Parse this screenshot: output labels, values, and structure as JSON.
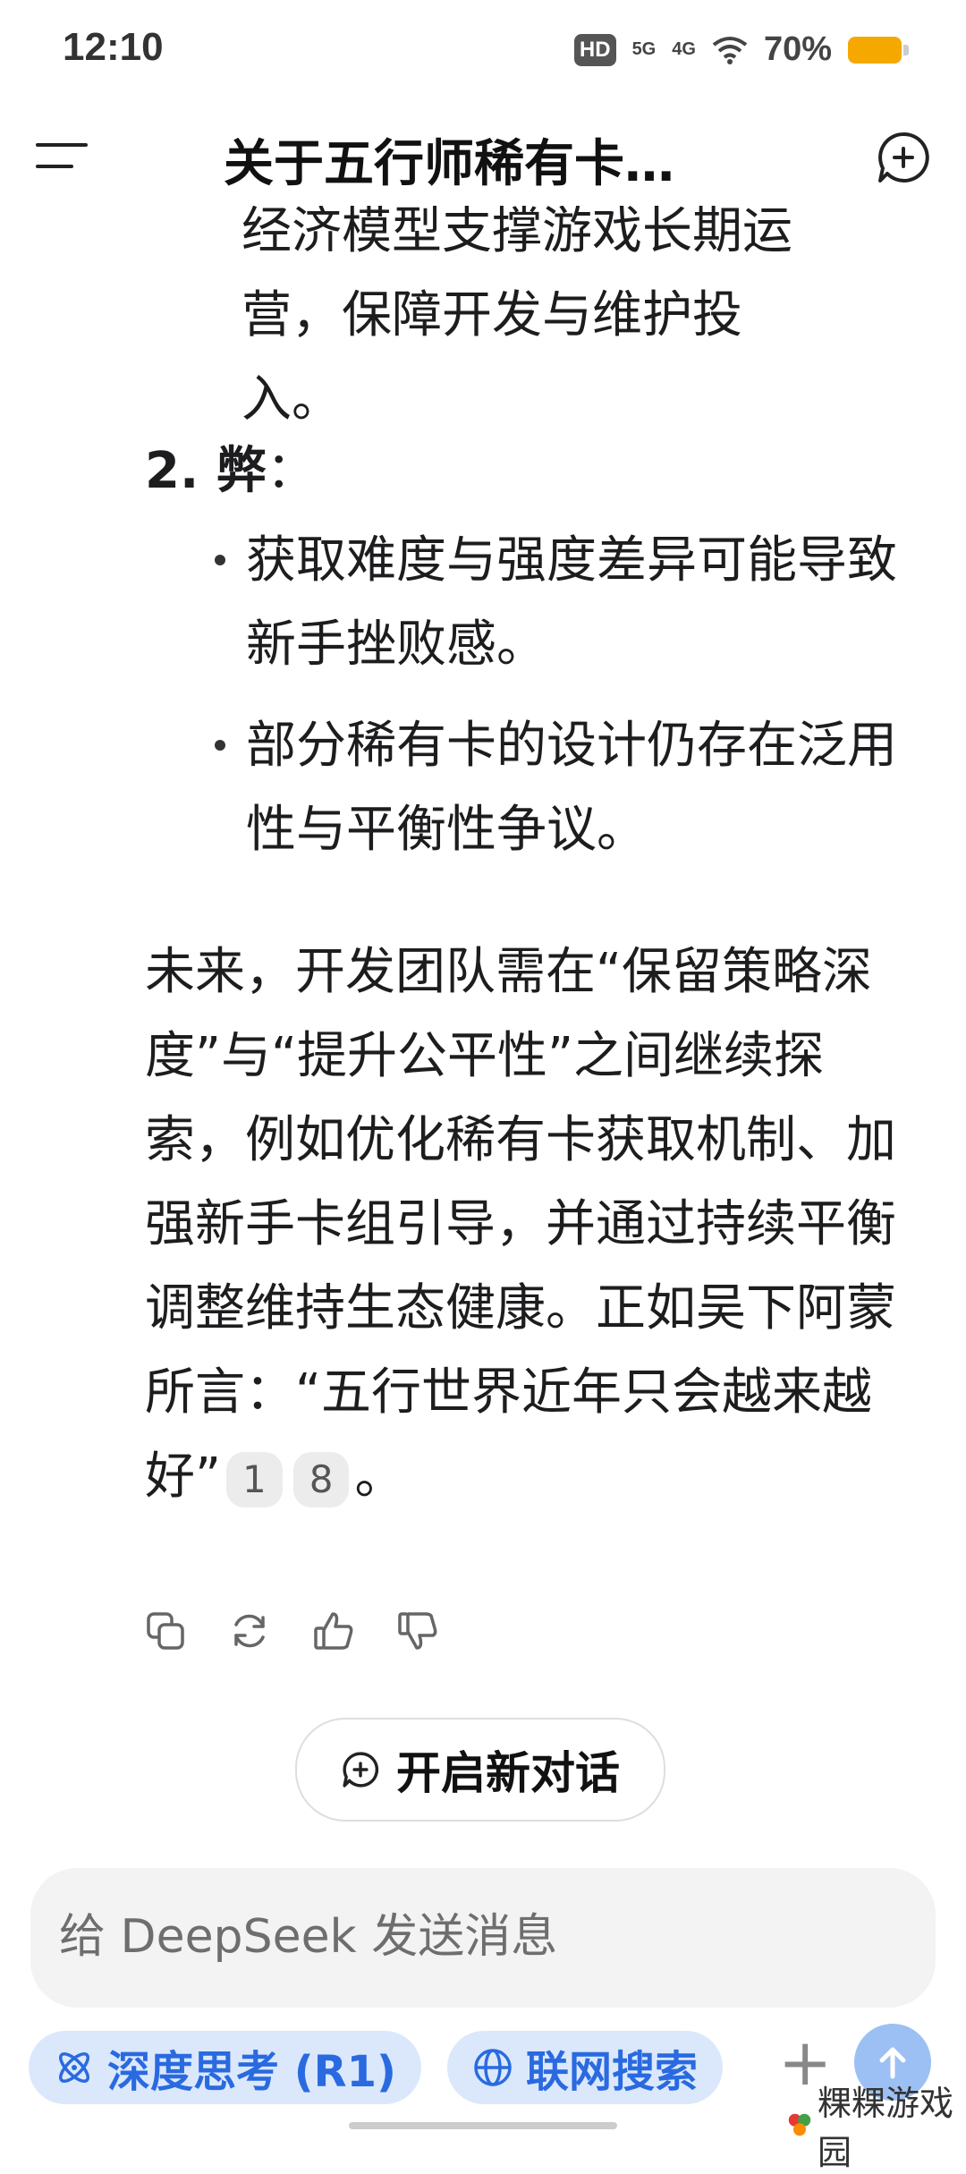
{
  "status": {
    "time": "12:10",
    "hd": "HD",
    "net5g": "5G",
    "net4g": "4G",
    "battery": "70%"
  },
  "header": {
    "title": "关于五行师稀有卡…"
  },
  "content": {
    "partial_lines": [
      "经济模型支撑游戏长期运",
      "营，保障开发与维护投",
      "入。"
    ],
    "section_number": "2.",
    "section_title": "弊",
    "section_colon": "：",
    "bullets": [
      "获取难度与强度差异可能导致新手挫败感。",
      "部分稀有卡的设计仍存在泛用性与平衡性争议。"
    ],
    "paragraph": "未来，开发团队需在“保留策略深度”与“提升公平性”之间继续探索，例如优化稀有卡获取机制、加强新手卡组引导，并通过持续平衡调整维持生态健康。正如吴下阿蒙所言：“五行世界近年只会越来越好”",
    "citations": [
      "1",
      "8"
    ],
    "paragraph_end": "。"
  },
  "actions": [
    "copy-icon",
    "regenerate-icon",
    "thumbs-up-icon",
    "thumbs-down-icon"
  ],
  "new_dialog_label": "开启新对话",
  "input": {
    "placeholder": "给 DeepSeek 发送消息"
  },
  "toolbar": {
    "deep_think_label": "深度思考 (R1)",
    "web_search_label": "联网搜索",
    "plus": "+"
  },
  "watermark": "粿粿游戏园",
  "colors": {
    "accent": "#2a6ae0",
    "pill_bg": "#dbe8fb",
    "send_bg": "#9cc0f3",
    "battery": "#f5a800"
  }
}
